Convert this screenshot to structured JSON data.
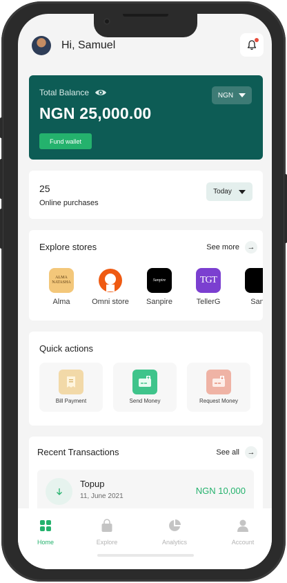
{
  "header": {
    "greeting": "Hi, Samuel"
  },
  "balance": {
    "label": "Total Balance",
    "amount": "NGN 25,000.00",
    "currency": "NGN",
    "fund_button": "Fund wallet"
  },
  "purchases": {
    "count": "25",
    "label": "Online purchases",
    "period": "Today"
  },
  "stores": {
    "title": "Explore stores",
    "see_more": "See more",
    "items": [
      {
        "name": "Alma",
        "logo_text": "ALMA NATASHA"
      },
      {
        "name": "Omni store"
      },
      {
        "name": "Sanpire",
        "logo_text": "Sanpire"
      },
      {
        "name": "TellerG",
        "logo_text": "TGT"
      },
      {
        "name": "San"
      }
    ]
  },
  "quick_actions": {
    "title": "Quick actions",
    "items": [
      {
        "label": "Bill Payment"
      },
      {
        "label": "Send Money"
      },
      {
        "label": "Request Money"
      }
    ]
  },
  "transactions": {
    "title": "Recent Transactions",
    "see_all": "See all",
    "items": [
      {
        "title": "Topup",
        "date": "11, June 2021",
        "amount": "NGN 10,000"
      }
    ]
  },
  "tabs": [
    {
      "label": "Home",
      "active": true
    },
    {
      "label": "Explore",
      "active": false
    },
    {
      "label": "Analytics",
      "active": false
    },
    {
      "label": "Account",
      "active": false
    }
  ],
  "colors": {
    "brand_dark": "#0d5c55",
    "accent_green": "#24b26d",
    "background": "#f4f4f4"
  }
}
